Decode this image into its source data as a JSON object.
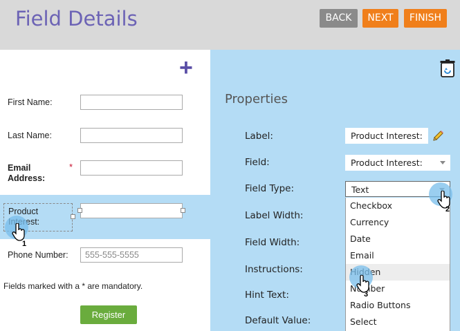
{
  "header": {
    "title": "Field Details",
    "buttons": {
      "back": "BACK",
      "next": "NEXT",
      "finish": "FINISH"
    }
  },
  "form": {
    "fields": {
      "first_name": "First Name:",
      "last_name": "Last Name:",
      "email": "Email Address:",
      "product_interest": "Product Interest:",
      "phone": "Phone Number:"
    },
    "required_mark": "*",
    "phone_placeholder": "555-555-5555",
    "mandatory_note": "Fields marked with a * are mandatory.",
    "register_label": "Register"
  },
  "properties": {
    "title": "Properties",
    "labels": {
      "label": "Label:",
      "field": "Field:",
      "field_type": "Field Type:",
      "label_width": "Label Width:",
      "field_width": "Field Width:",
      "instructions": "Instructions:",
      "hint_text": "Hint Text:",
      "default_value": "Default Value:"
    },
    "values": {
      "label": "Product Interest:",
      "field": "Product Interest:",
      "field_type": "Text"
    },
    "field_type_options": [
      "Checkbox",
      "Currency",
      "Date",
      "Email",
      "Hidden",
      "Number",
      "Radio Buttons",
      "Select"
    ]
  },
  "steps": [
    "1",
    "2",
    "3"
  ],
  "icons": {
    "add": "plus-icon",
    "delete": "trash-icon",
    "edit": "pencil-icon",
    "cursor": "hand-cursor-icon"
  },
  "colors": {
    "accent_orange": "#f07f1b",
    "title_purple": "#6c63b5",
    "panel_blue": "#b4dcf5",
    "register_green": "#6aac3d"
  }
}
